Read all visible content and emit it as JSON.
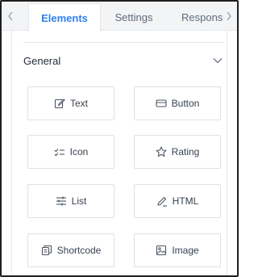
{
  "tabs": [
    {
      "label": "Elements",
      "active": true
    },
    {
      "label": "Settings",
      "active": false
    },
    {
      "label": "Responsi",
      "active": false
    }
  ],
  "section": {
    "title": "General",
    "expanded": true
  },
  "elements": [
    {
      "label": "Text",
      "icon": "edit-icon"
    },
    {
      "label": "Button",
      "icon": "button-icon"
    },
    {
      "label": "Icon",
      "icon": "checklist-icon"
    },
    {
      "label": "Rating",
      "icon": "star-icon"
    },
    {
      "label": "List",
      "icon": "sliders-icon"
    },
    {
      "label": "HTML",
      "icon": "pen-icon"
    },
    {
      "label": "Shortcode",
      "icon": "shortcode-icon"
    },
    {
      "label": "Image",
      "icon": "image-icon"
    }
  ],
  "colors": {
    "accent": "#2f80ed",
    "text": "#374151",
    "border": "#dde1e6"
  }
}
